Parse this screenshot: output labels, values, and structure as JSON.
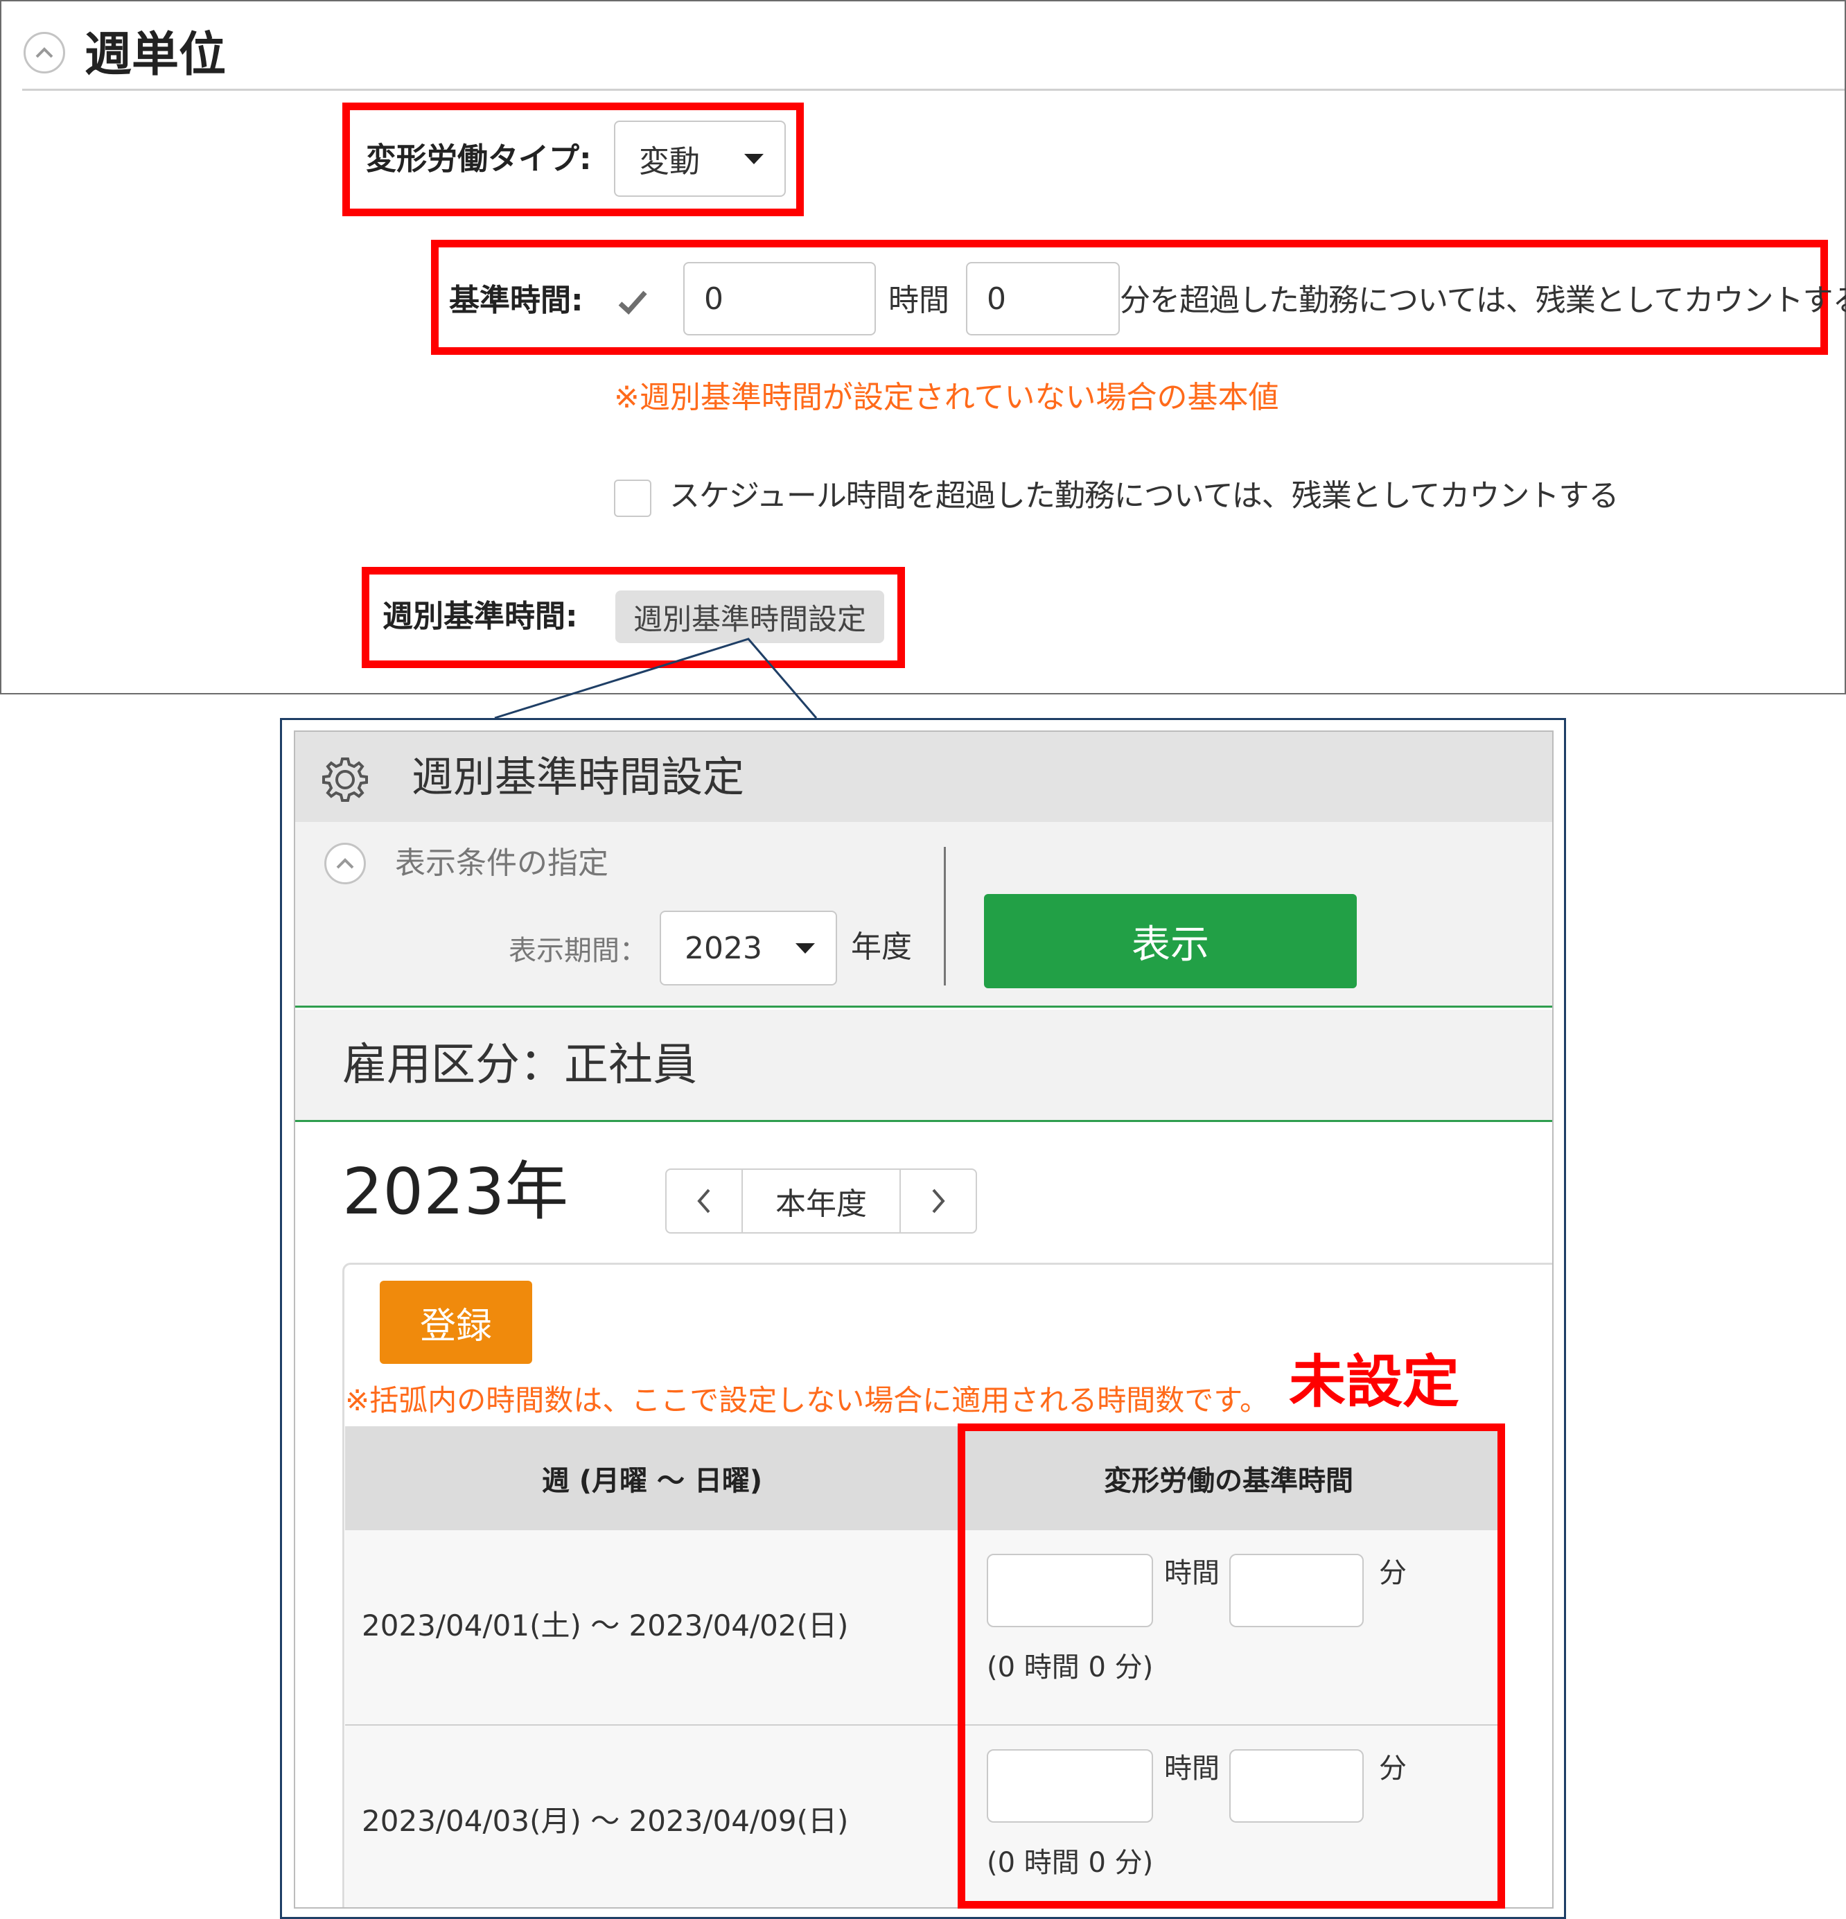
{
  "weekly_section": {
    "title": "週単位",
    "variable_type": {
      "label": "変形労働タイプ:",
      "value": "変動"
    },
    "base_time": {
      "label": "基準時間:",
      "checked": true,
      "hours_value": "0",
      "hours_unit": "時間",
      "minutes_value": "0",
      "suffix": "分を超過した勤務については、残業としてカウントする",
      "note": "※週別基準時間が設定されていない場合の基本値"
    },
    "schedule_option": {
      "checked": false,
      "label": "スケジュール時間を超過した勤務については、残業としてカウントする"
    },
    "weekly_base": {
      "label": "週別基準時間:",
      "button_label": "週別基準時間設定"
    }
  },
  "popup": {
    "title": "週別基準時間設定",
    "conditions": {
      "section_label": "表示条件の指定",
      "period_label": "表示期間：",
      "year_value": "2023",
      "year_suffix": "年度",
      "show_button": "表示"
    },
    "employment": "雇用区分：正社員",
    "year_heading": "2023年",
    "nav": {
      "this_year": "本年度"
    },
    "register_button": "登録",
    "note": "※括弧内の時間数は、ここで設定しない場合に適用される時間数です。",
    "unset_label": "未設定",
    "table": {
      "headers": [
        "週 (月曜 ～ 日曜)",
        "変形労働の基準時間"
      ],
      "hours_unit": "時間",
      "minutes_unit": "分",
      "rows": [
        {
          "week": "2023/04/01(土) ～ 2023/04/02(日)",
          "default": "(0 時間 0 分)"
        },
        {
          "week": "2023/04/03(月) ～ 2023/04/09(日)",
          "default": "(0 時間 0 分)"
        }
      ]
    }
  },
  "colors": {
    "highlight_red": "#ff0000",
    "note_orange": "#ff6a1a",
    "show_green": "#22a046",
    "register_orange": "#f08a0c"
  },
  "icons": [
    "chevron-up-icon",
    "dropdown-caret-icon",
    "check-icon",
    "gear-icon",
    "chevron-left-icon",
    "chevron-right-icon"
  ]
}
